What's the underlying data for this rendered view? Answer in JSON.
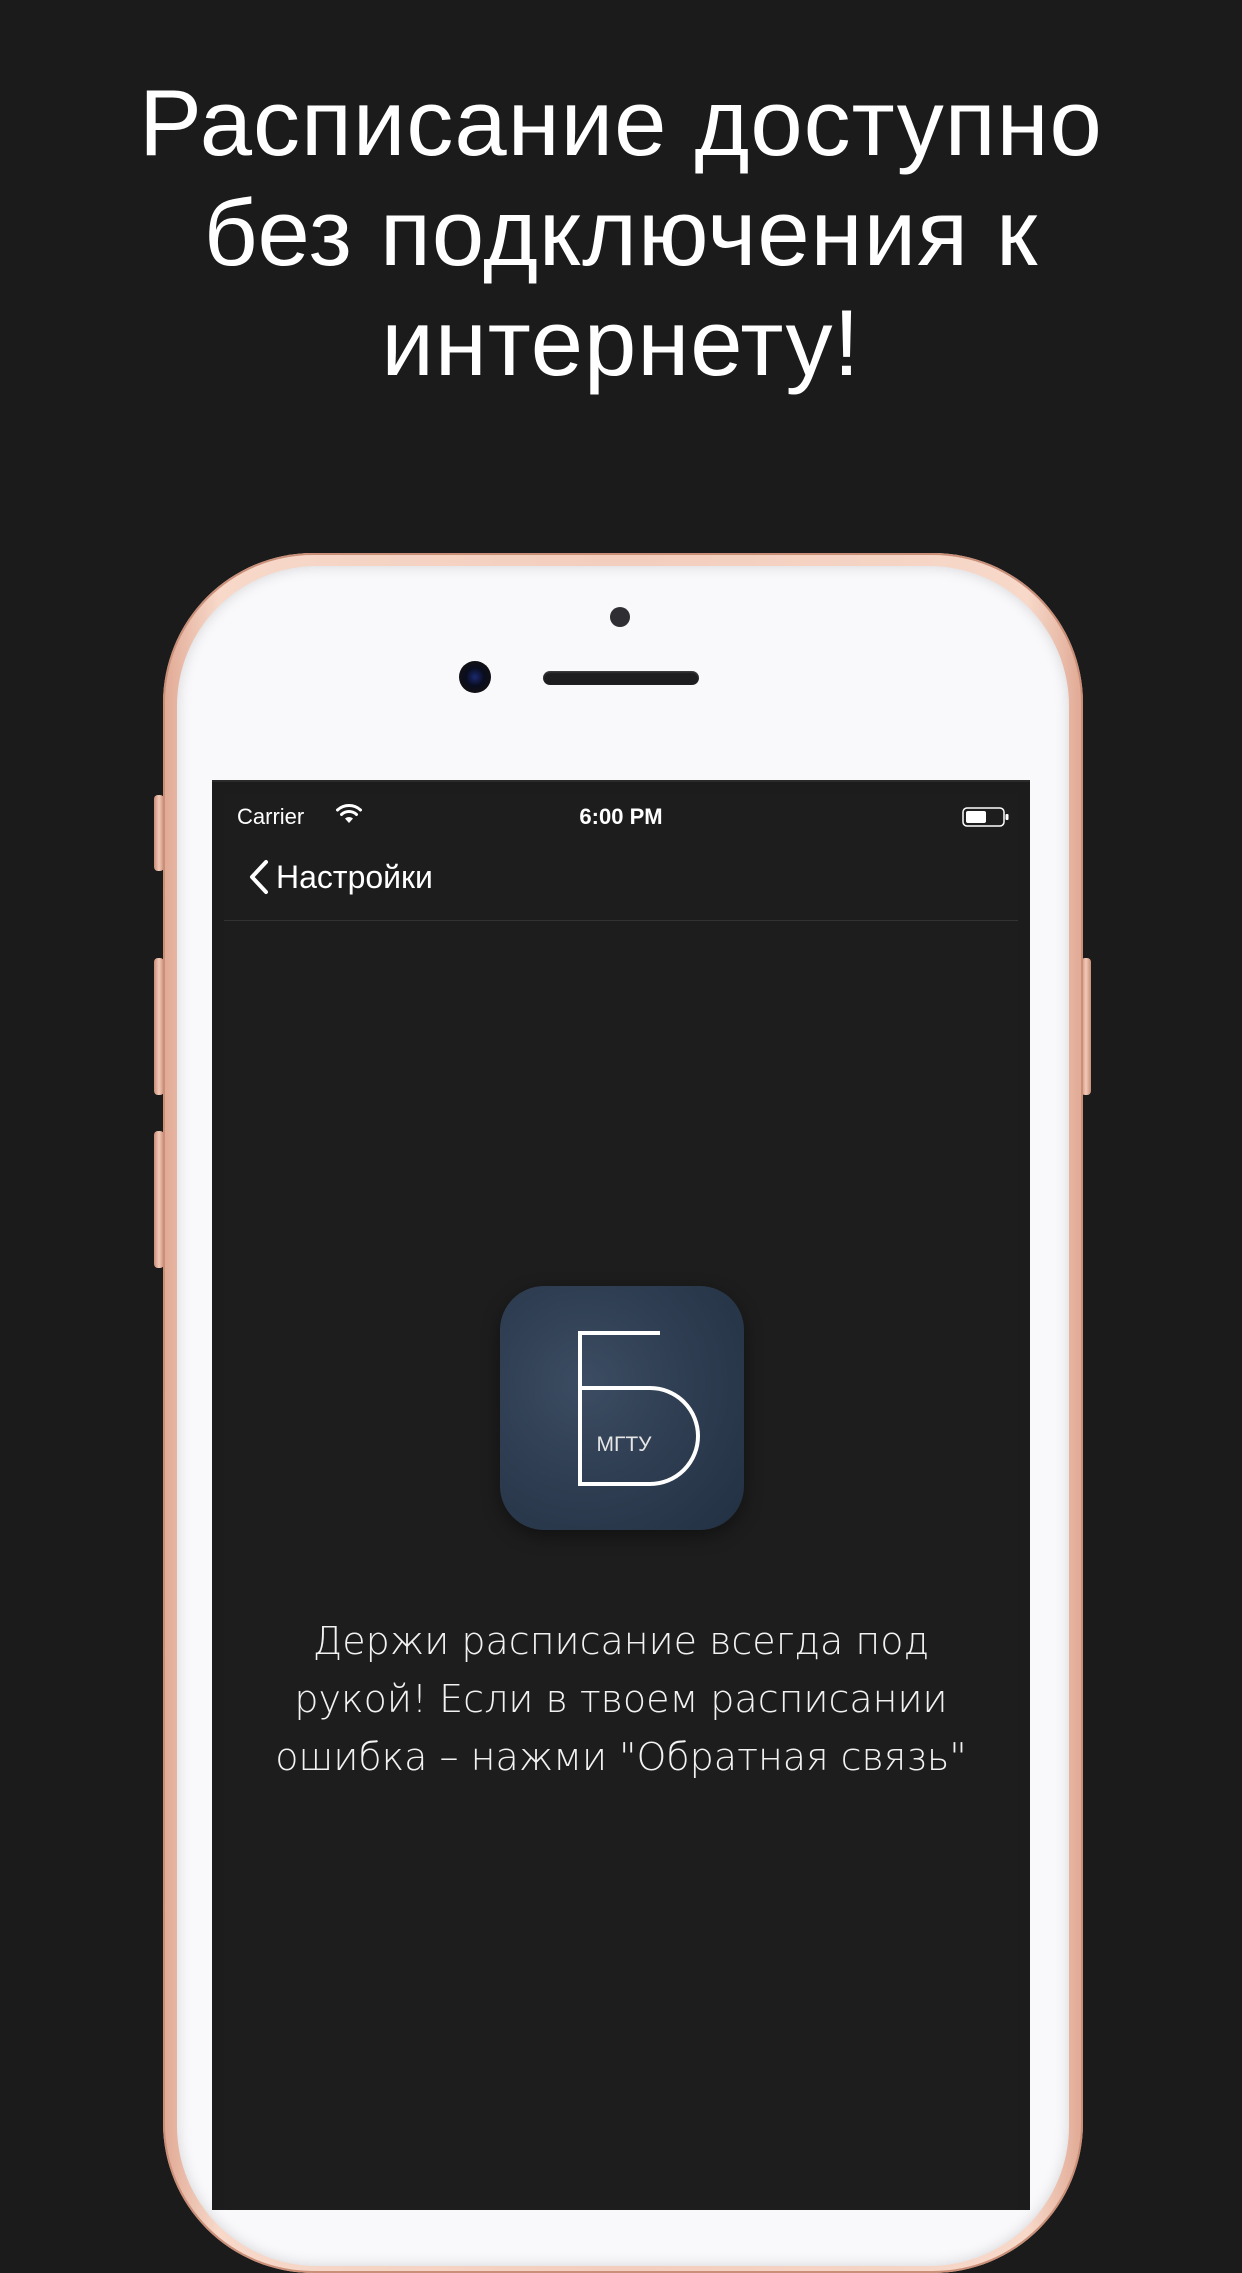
{
  "headline": {
    "lines": [
      "Расписание доступно",
      "без подключения к",
      "интернету!"
    ]
  },
  "status_bar": {
    "carrier": "Carrier",
    "time": "6:00 PM",
    "icons": [
      "wifi-icon",
      "battery-icon"
    ]
  },
  "nav": {
    "back_label": "Настройки",
    "back_icon": "chevron-left-icon"
  },
  "logo": {
    "letter": "Б",
    "caption": "МГТУ"
  },
  "description": {
    "lines": [
      "Держи расписание всегда под",
      "рукой! Если в твоем расписании",
      "ошибка – нажми \"Обратная связь\""
    ]
  },
  "colors": {
    "background": "#1b1b1b",
    "screen": "#1d1d1d",
    "phone_frame": "#f3cdbd",
    "phone_face": "#f9f9fb",
    "logo_background": "#2f3e52",
    "text": "#ffffff"
  }
}
